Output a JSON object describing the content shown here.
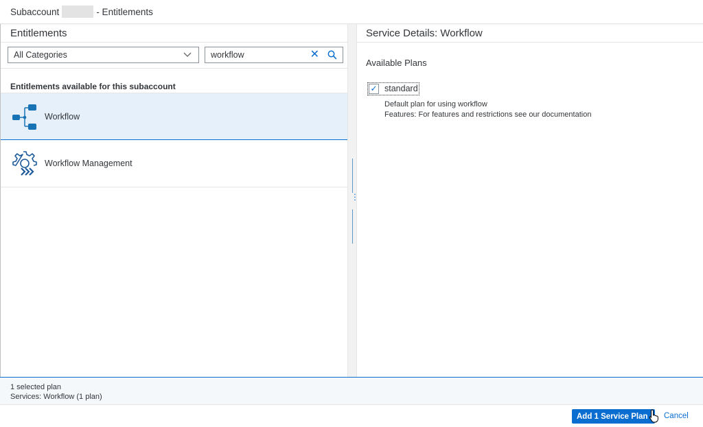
{
  "header": {
    "title_prefix": "Subaccount",
    "title_suffix": "- Entitlements"
  },
  "left": {
    "title": "Entitlements",
    "category_select": {
      "value": "All Categories"
    },
    "search": {
      "value": "workflow"
    },
    "section_label": "Entitlements available for this subaccount",
    "items": [
      {
        "label": "Workflow",
        "icon": "workflow-icon",
        "selected": true
      },
      {
        "label": "Workflow Management",
        "icon": "workflow-management-icon",
        "selected": false
      }
    ]
  },
  "right": {
    "title": "Service Details: Workflow",
    "available_plans_label": "Available Plans",
    "plan": {
      "label": "standard",
      "checked": true,
      "description_line1": "Default plan for using workflow",
      "description_line2": "Features: For features and restrictions see our documentation"
    }
  },
  "status": {
    "line1": "1 selected plan",
    "line2": "Services: Workflow (1 plan)"
  },
  "footer": {
    "primary_label": "Add 1 Service Plan",
    "cancel_label": "Cancel"
  },
  "colors": {
    "accent": "#0a6ed1",
    "selected_bg": "#e5f0fa",
    "status_bg": "#f4f8fb"
  }
}
